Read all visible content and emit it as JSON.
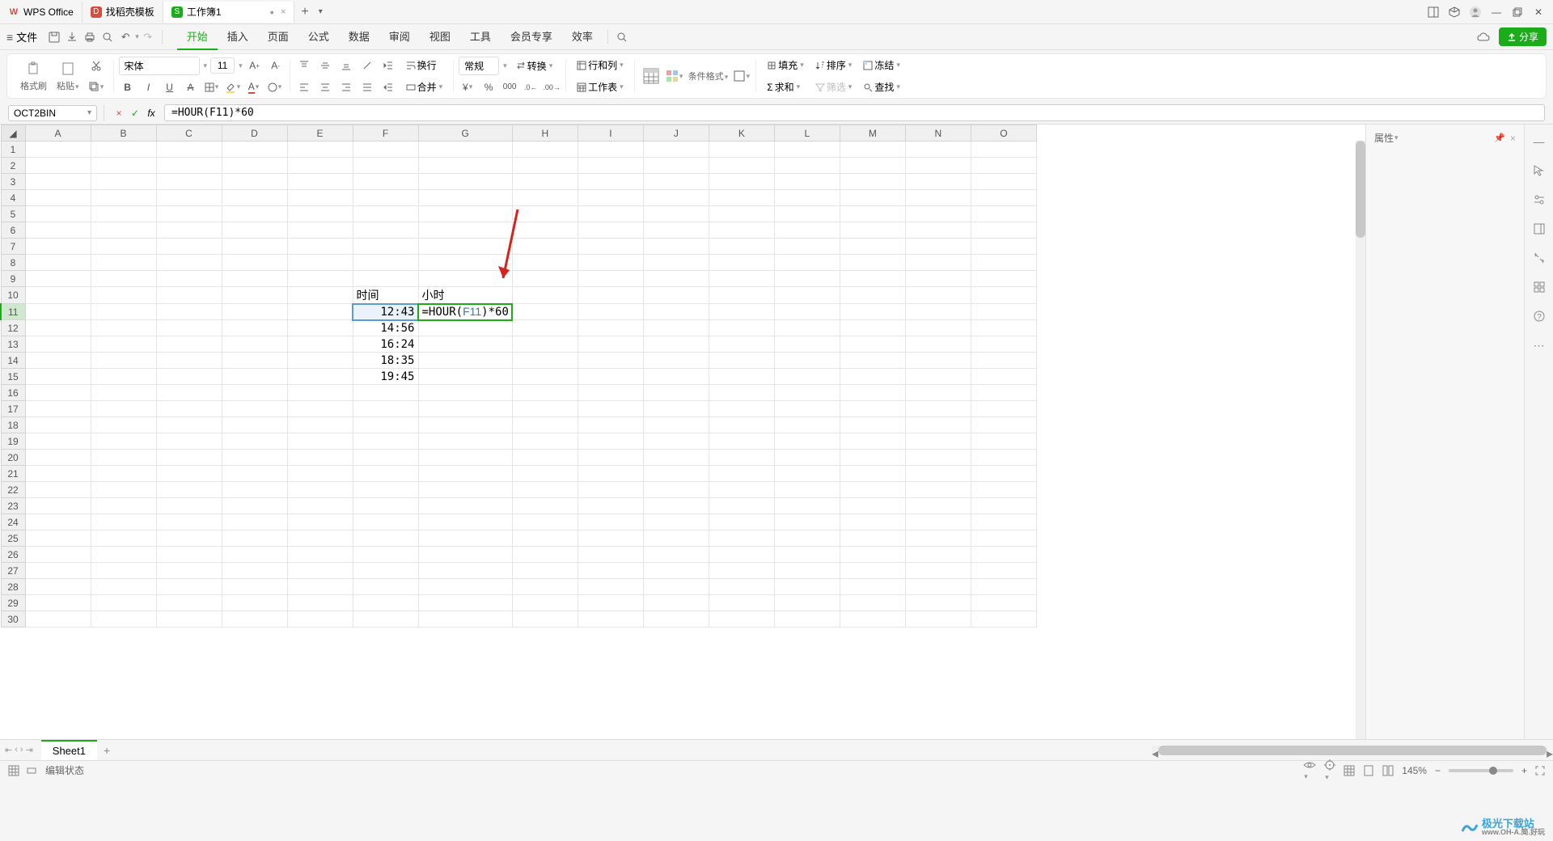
{
  "tabs": {
    "items": [
      {
        "icon": "wps",
        "label": "WPS Office",
        "color": "#d94b3a"
      },
      {
        "icon": "docer",
        "label": "找稻壳模板",
        "color": "#d94b3a"
      },
      {
        "icon": "sheet",
        "label": "工作簿1",
        "color": "#1aad19",
        "active": true,
        "dirty": "●"
      }
    ],
    "add": "+"
  },
  "winControls": {
    "layout": "▢",
    "box": "⬚",
    "user": "👤"
  },
  "menu": {
    "file": "文件",
    "iconbuttons": [
      "save",
      "export",
      "print",
      "print-preview"
    ],
    "undo": "↶",
    "redo": "↷",
    "tabs": [
      "开始",
      "插入",
      "页面",
      "公式",
      "数据",
      "审阅",
      "视图",
      "工具",
      "会员专享",
      "效率"
    ],
    "active": 0,
    "cloud": "☁",
    "share": "分享"
  },
  "toolbar": {
    "paste": {
      "brush": "格式刷",
      "paste": "粘贴"
    },
    "font": {
      "name": "宋体",
      "size": "11"
    },
    "number": {
      "format": "常规",
      "convert": "转换"
    },
    "table": {
      "rowcol": "行和列",
      "worksheet": "工作表"
    },
    "layout": {
      "condfmt": "条件格式"
    },
    "tools": {
      "fill": "填充",
      "sum": "求和",
      "sort": "排序",
      "filter": "筛选",
      "freeze": "冻结",
      "find": "查找"
    }
  },
  "formulaBar": {
    "name": "OCT2BIN",
    "cancel": "×",
    "accept": "✓",
    "fx": "fx",
    "formula": "=HOUR(F11)*60"
  },
  "grid": {
    "cols": [
      "A",
      "B",
      "C",
      "D",
      "E",
      "F",
      "G",
      "H",
      "I",
      "J",
      "K",
      "L",
      "M",
      "N",
      "O"
    ],
    "rows": 30,
    "activeRow": 11,
    "header": {
      "F10": "时间",
      "G10": "小时"
    },
    "data": {
      "F11": "12:43",
      "F12": "14:56",
      "F13": "16:24",
      "F14": "18:35",
      "F15": "19:45"
    },
    "editCell": {
      "ref": "G11",
      "display_prefix": "=HOUR(",
      "display_arg": "F11",
      "display_suffix": ")*60"
    },
    "refCell": "F11"
  },
  "sidePanel": {
    "title": "属性"
  },
  "rail": [
    "select",
    "settings",
    "panel",
    "fx",
    "grid",
    "help",
    "more"
  ],
  "sheets": {
    "active": "Sheet1",
    "add": "+"
  },
  "status": {
    "mode": "编辑状态",
    "zoom": "145%"
  },
  "watermark": {
    "text1": "极光下载站",
    "text2": "www.OH-A.简.好玩"
  }
}
